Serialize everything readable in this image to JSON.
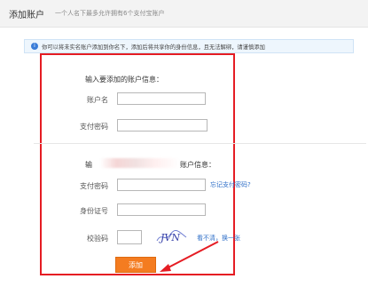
{
  "header": {
    "title": "添加账户",
    "subtitle": "一个人名下最多允许拥有6个支付宝账户"
  },
  "notice": {
    "icon": "info-icon",
    "text": "你可以将未实名账户添加到你名下，添加后将共享你的身份信息，且无法解绑，请谨慎添加"
  },
  "account_section": {
    "title": "输入要添加的账户信息：",
    "account_label": "账户名",
    "account_value": "",
    "password_label": "支付密码",
    "password_value": ""
  },
  "owner_section": {
    "title_prefix": "输",
    "title_suffix": "账户信息：",
    "password_label": "支付密码",
    "password_value": "",
    "forgot_link": "忘记支付密码?",
    "id_label": "身份证号",
    "id_value": "",
    "captcha_label": "校验码",
    "captcha_value": "",
    "captcha_text": "JVN",
    "refresh_link": "看不清，换一张"
  },
  "submit": {
    "label": "添加"
  },
  "colors": {
    "highlight_box": "#e51c23",
    "submit_button": "#f47c20",
    "link": "#2f6fc8"
  }
}
